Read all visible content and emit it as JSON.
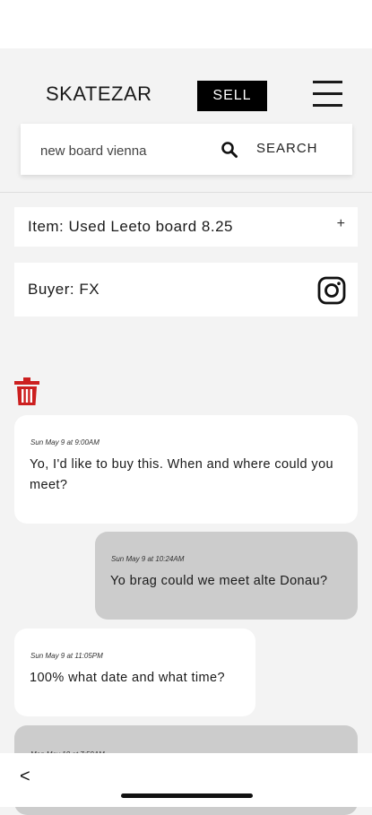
{
  "header": {
    "brand": "SKATEZAR",
    "sell_label": "SELL",
    "menu_icon": "hamburger-menu-icon"
  },
  "search": {
    "value": "new board vienna",
    "placeholder": "",
    "button_label": "SEARCH",
    "icon": "search-icon"
  },
  "item": {
    "label": "Item: Used Leeto board 8.25",
    "expand_symbol": "+"
  },
  "buyer": {
    "label": "Buyer: FX",
    "icon": "instagram-icon"
  },
  "actions": {
    "delete_icon": "trash-icon",
    "delete_color": "#cc1f1f"
  },
  "messages": [
    {
      "direction": "incoming",
      "time": "Sun May 9 at 9:00AM",
      "text": "Yo, I'd like to buy this. When and where could you meet?"
    },
    {
      "direction": "outgoing",
      "time": "Sun May 9 at 10:24AM",
      "text": "Yo brag could we meet alte Donau?"
    },
    {
      "direction": "incoming",
      "time": "Sun May 9 at 11:05PM",
      "text": "100% what date and what time?"
    },
    {
      "direction": "outgoing",
      "time": "Mon May 10 at 7:50AM",
      "text": ""
    }
  ],
  "footer": {
    "back_label": "<"
  },
  "colors": {
    "background": "#f3f3f3",
    "card": "#ffffff",
    "incoming_bubble": "#ffffff",
    "outgoing_bubble": "#cccccc",
    "sell_button": "#000000",
    "delete": "#cc1f1f"
  }
}
